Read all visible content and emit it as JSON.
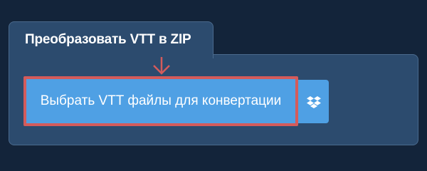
{
  "converter": {
    "tab_title": "Преобразовать VTT в ZIP",
    "select_button_label": "Выбрать VTT файлы для конвертации",
    "dropbox_icon": "dropbox-icon",
    "arrow_icon": "arrow-down-icon"
  },
  "colors": {
    "background": "#13243a",
    "panel": "#2c4b6e",
    "panel_border": "#4a6a8d",
    "button": "#4fa0e4",
    "highlight": "#d45b5b",
    "text": "#ffffff"
  }
}
